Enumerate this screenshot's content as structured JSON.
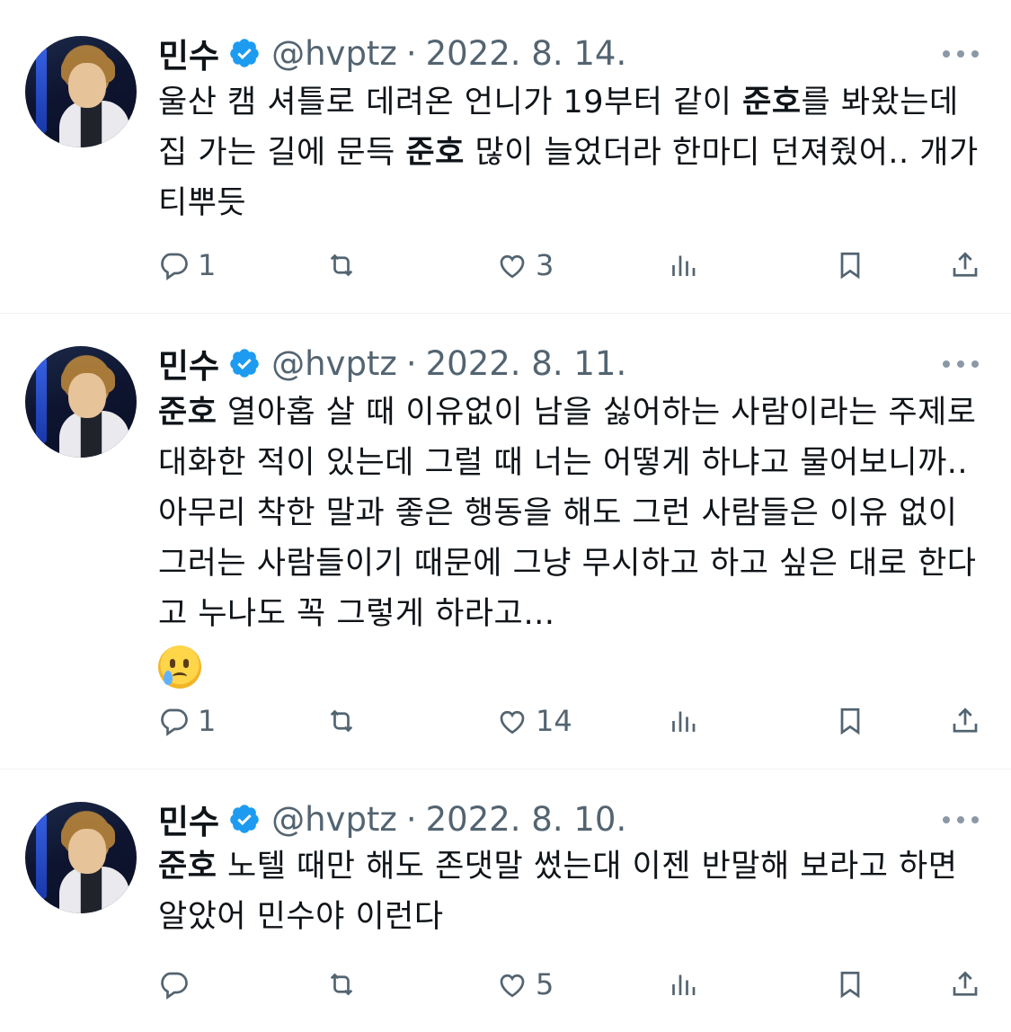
{
  "tweets": [
    {
      "name": "민수",
      "handle": "@hvptz",
      "separator": "·",
      "date": "2022. 8. 14.",
      "text_parts": [
        "울산 캠 셔틀로 데려온 언니가 19부터 같이 ",
        "준호",
        "를 봐왔는데 집 가는 길에 문득 ",
        "준호",
        " 많이 늘었더라 한마디 던져줬어.. 개가티뿌듯"
      ],
      "replies": "1",
      "retweets": "",
      "likes": "3"
    },
    {
      "name": "민수",
      "handle": "@hvptz",
      "separator": "·",
      "date": "2022. 8. 11.",
      "text_parts": [
        "준호",
        " 열아홉 살 때 이유없이 남을 싫어하는 사람이라는 주제로 대화한 적이 있는데 그럴 때 너는 어떻게 하냐고 물어보니까.. 아무리 착한 말과 좋은 행동을 해도 그런 사람들은 이유 없이 그러는 사람들이기 때문에 그냥 무시하고 하고 싶은 대로 한다고 누나도 꼭 그렇게 하라고…"
      ],
      "emoji": "face-holding-back-tears",
      "replies": "1",
      "retweets": "",
      "likes": "14"
    },
    {
      "name": "민수",
      "handle": "@hvptz",
      "separator": "·",
      "date": "2022. 8. 10.",
      "text_parts": [
        "준호",
        " 노텔 때만 해도 존댓말 썼는대 이젠 반말해 보라고 하면 알았어 민수야 이런다"
      ],
      "replies": "",
      "retweets": "",
      "likes": "5"
    }
  ],
  "icons": {
    "verified": "verified-badge-icon",
    "more": "more-options-icon",
    "reply": "reply-icon",
    "retweet": "retweet-icon",
    "like": "heart-icon",
    "views": "views-chart-icon",
    "bookmark": "bookmark-icon",
    "share": "share-icon"
  },
  "colors": {
    "verified_blue": "#1d9bf0",
    "secondary_text": "#536471",
    "primary_text": "#0f1419",
    "divider": "#eff3f4"
  }
}
